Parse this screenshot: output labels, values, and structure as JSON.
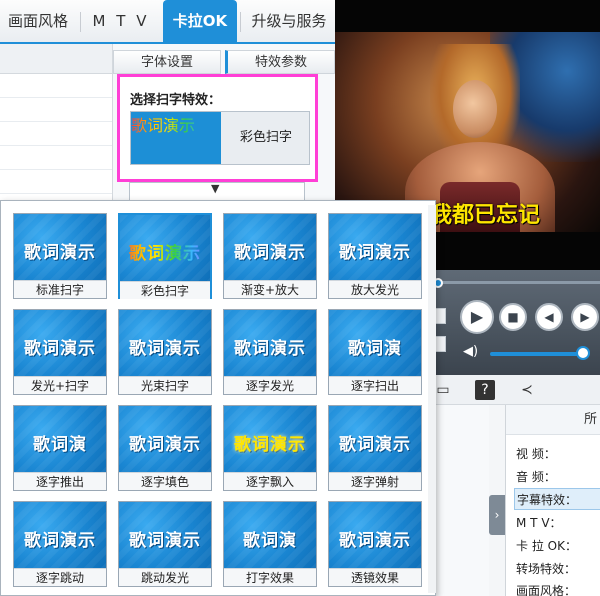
{
  "tabs": [
    {
      "label": "画面风格"
    },
    {
      "label": "M T V"
    },
    {
      "label": "卡拉OK"
    },
    {
      "label": "升级与服务"
    }
  ],
  "settings": {
    "subtabs": [
      {
        "label": "字体设置"
      },
      {
        "label": "特效参数"
      }
    ],
    "select_label": "选择扫字特效：",
    "selected_name": "彩色扫字",
    "selected_preview": "歌词演示"
  },
  "video": {
    "lyric": "我都已忘记"
  },
  "effects": [
    {
      "preview": "歌词演示",
      "name": "标准扫字"
    },
    {
      "preview": "歌词演示",
      "name": "彩色扫字"
    },
    {
      "preview": "歌词演示",
      "name": "渐变+放大"
    },
    {
      "preview": "歌词演示",
      "name": "放大发光"
    },
    {
      "preview": "歌词演示",
      "name": "发光+扫字"
    },
    {
      "preview": "歌词演示",
      "name": "光束扫字"
    },
    {
      "preview": "歌词演示",
      "name": "逐字发光"
    },
    {
      "preview": "歌词演",
      "name": "逐字扫出"
    },
    {
      "preview": "歌词演",
      "name": "逐字推出"
    },
    {
      "preview": "歌词演示",
      "name": "逐字填色"
    },
    {
      "preview": "歌词演示",
      "name": "逐字飘入"
    },
    {
      "preview": "歌词演示",
      "name": "逐字弹射"
    },
    {
      "preview": "歌词演示",
      "name": "逐字跳动"
    },
    {
      "preview": "歌词演示",
      "name": "跳动发光"
    },
    {
      "preview": "歌词演",
      "name": "打字效果"
    },
    {
      "preview": "歌词演示",
      "name": "透镜效果"
    }
  ],
  "side": {
    "title": "所",
    "rows": [
      {
        "label": "视    频："
      },
      {
        "label": "音    频："
      },
      {
        "label": "字幕特效："
      },
      {
        "label": "M  T  V："
      },
      {
        "label": "卡 拉 OK："
      },
      {
        "label": "转场特效："
      },
      {
        "label": "画面风格："
      }
    ]
  },
  "icons": {
    "play": "play-icon",
    "stop": "stop-icon",
    "prev": "prev-icon",
    "next": "next-icon",
    "volume": "volume-icon",
    "help": "help-icon",
    "share": "share-icon",
    "expand": "chevron-right-icon"
  },
  "colors": {
    "accent": "#1f8fd8",
    "highlight_box": "#ff3fd6"
  }
}
